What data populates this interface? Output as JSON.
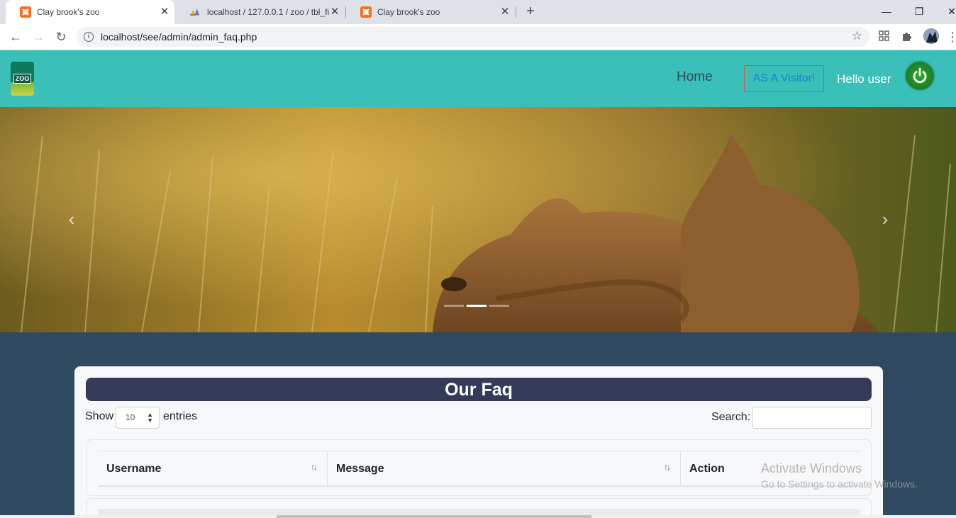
{
  "browser": {
    "tabs": [
      {
        "title": "Clay brook's zoo",
        "favicon": "xampp-icon",
        "active": true
      },
      {
        "title": "localhost / 127.0.0.1 / zoo / tbl_fi",
        "favicon": "phpmyadmin-icon",
        "active": false
      },
      {
        "title": "Clay brook's zoo",
        "favicon": "xampp-icon",
        "active": false
      }
    ],
    "new_tab_glyph": "+",
    "url": "localhost/see/admin/admin_faq.php"
  },
  "navbar": {
    "logo_text": "ZOO",
    "home_label": "Home",
    "visitor_button_label": "AS A Visitor!",
    "greeting": "Hello user",
    "accent_color": "#3bbfb9"
  },
  "carousel": {
    "indicator_count": 3,
    "active_index": 1
  },
  "faq": {
    "title": "Our Faq",
    "show_label": "Show",
    "entries_value": "10",
    "entries_label": "entries",
    "search_label": "Search:",
    "search_value": "",
    "columns": [
      "Username",
      "Message",
      "Action"
    ]
  },
  "watermark": {
    "line1": "Activate Windows",
    "line2": "Go to Settings to activate Windows."
  }
}
